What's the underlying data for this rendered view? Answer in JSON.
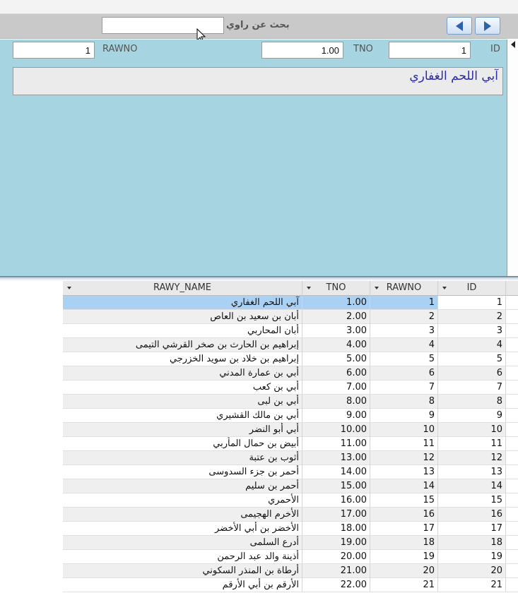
{
  "header": {
    "search_label": "بحث عن راوي",
    "search_value": "",
    "prev_icon": "triangle-left-icon",
    "next_icon": "triangle-right-icon"
  },
  "form": {
    "id_label": "ID",
    "id_value": "1",
    "tno_label": "TNO",
    "tno_value": "1.00",
    "rawno_label": "RAWNO",
    "rawno_value": "1",
    "rawy_name": "آبي اللحم الغفاري"
  },
  "grid": {
    "columns": [
      "RAWY_NAME",
      "TNO",
      "RAWNO",
      "ID"
    ],
    "rows": [
      {
        "name": "آبي اللحم الغفاري",
        "tno": "1.00",
        "rawno": "1",
        "id": "1"
      },
      {
        "name": "أبان بن سعيد بن العاص",
        "tno": "2.00",
        "rawno": "2",
        "id": "2"
      },
      {
        "name": "أبان المحاربي",
        "tno": "3.00",
        "rawno": "3",
        "id": "3"
      },
      {
        "name": "إبراهيم بن الحارث بن صخر القرشي التيمى",
        "tno": "4.00",
        "rawno": "4",
        "id": "4"
      },
      {
        "name": "إبراهيم بن خلاد بن سويد الخزرجي",
        "tno": "5.00",
        "rawno": "5",
        "id": "5"
      },
      {
        "name": "أبي بن عمارة المدني",
        "tno": "6.00",
        "rawno": "6",
        "id": "6"
      },
      {
        "name": "أبي بن كعب",
        "tno": "7.00",
        "rawno": "7",
        "id": "7"
      },
      {
        "name": "أبي بن لبى",
        "tno": "8.00",
        "rawno": "8",
        "id": "8"
      },
      {
        "name": "أبي بن مالك القشيري",
        "tno": "9.00",
        "rawno": "9",
        "id": "9"
      },
      {
        "name": "أبي أبو النضر",
        "tno": "10.00",
        "rawno": "10",
        "id": "10"
      },
      {
        "name": "أبيض بن حمال المأربي",
        "tno": "11.00",
        "rawno": "11",
        "id": "11"
      },
      {
        "name": "أثوب بن عتبة",
        "tno": "13.00",
        "rawno": "12",
        "id": "12"
      },
      {
        "name": "أحمر بن جزء السدوسى",
        "tno": "14.00",
        "rawno": "13",
        "id": "13"
      },
      {
        "name": "أحمر بن سليم",
        "tno": "15.00",
        "rawno": "14",
        "id": "14"
      },
      {
        "name": "الأحمري",
        "tno": "16.00",
        "rawno": "15",
        "id": "15"
      },
      {
        "name": "الأخرم الهجيمى",
        "tno": "17.00",
        "rawno": "16",
        "id": "16"
      },
      {
        "name": "الأخضر بن أبي الأخضر",
        "tno": "18.00",
        "rawno": "17",
        "id": "17"
      },
      {
        "name": "أدرع السلمى",
        "tno": "19.00",
        "rawno": "18",
        "id": "18"
      },
      {
        "name": "أذينة والد عبد الرحمن",
        "tno": "20.00",
        "rawno": "19",
        "id": "19"
      },
      {
        "name": "أرطاة بن المنذر السكوني",
        "tno": "21.00",
        "rawno": "20",
        "id": "20"
      },
      {
        "name": "الأرقم بن أبي الأرقم",
        "tno": "22.00",
        "rawno": "21",
        "id": "21"
      }
    ]
  }
}
